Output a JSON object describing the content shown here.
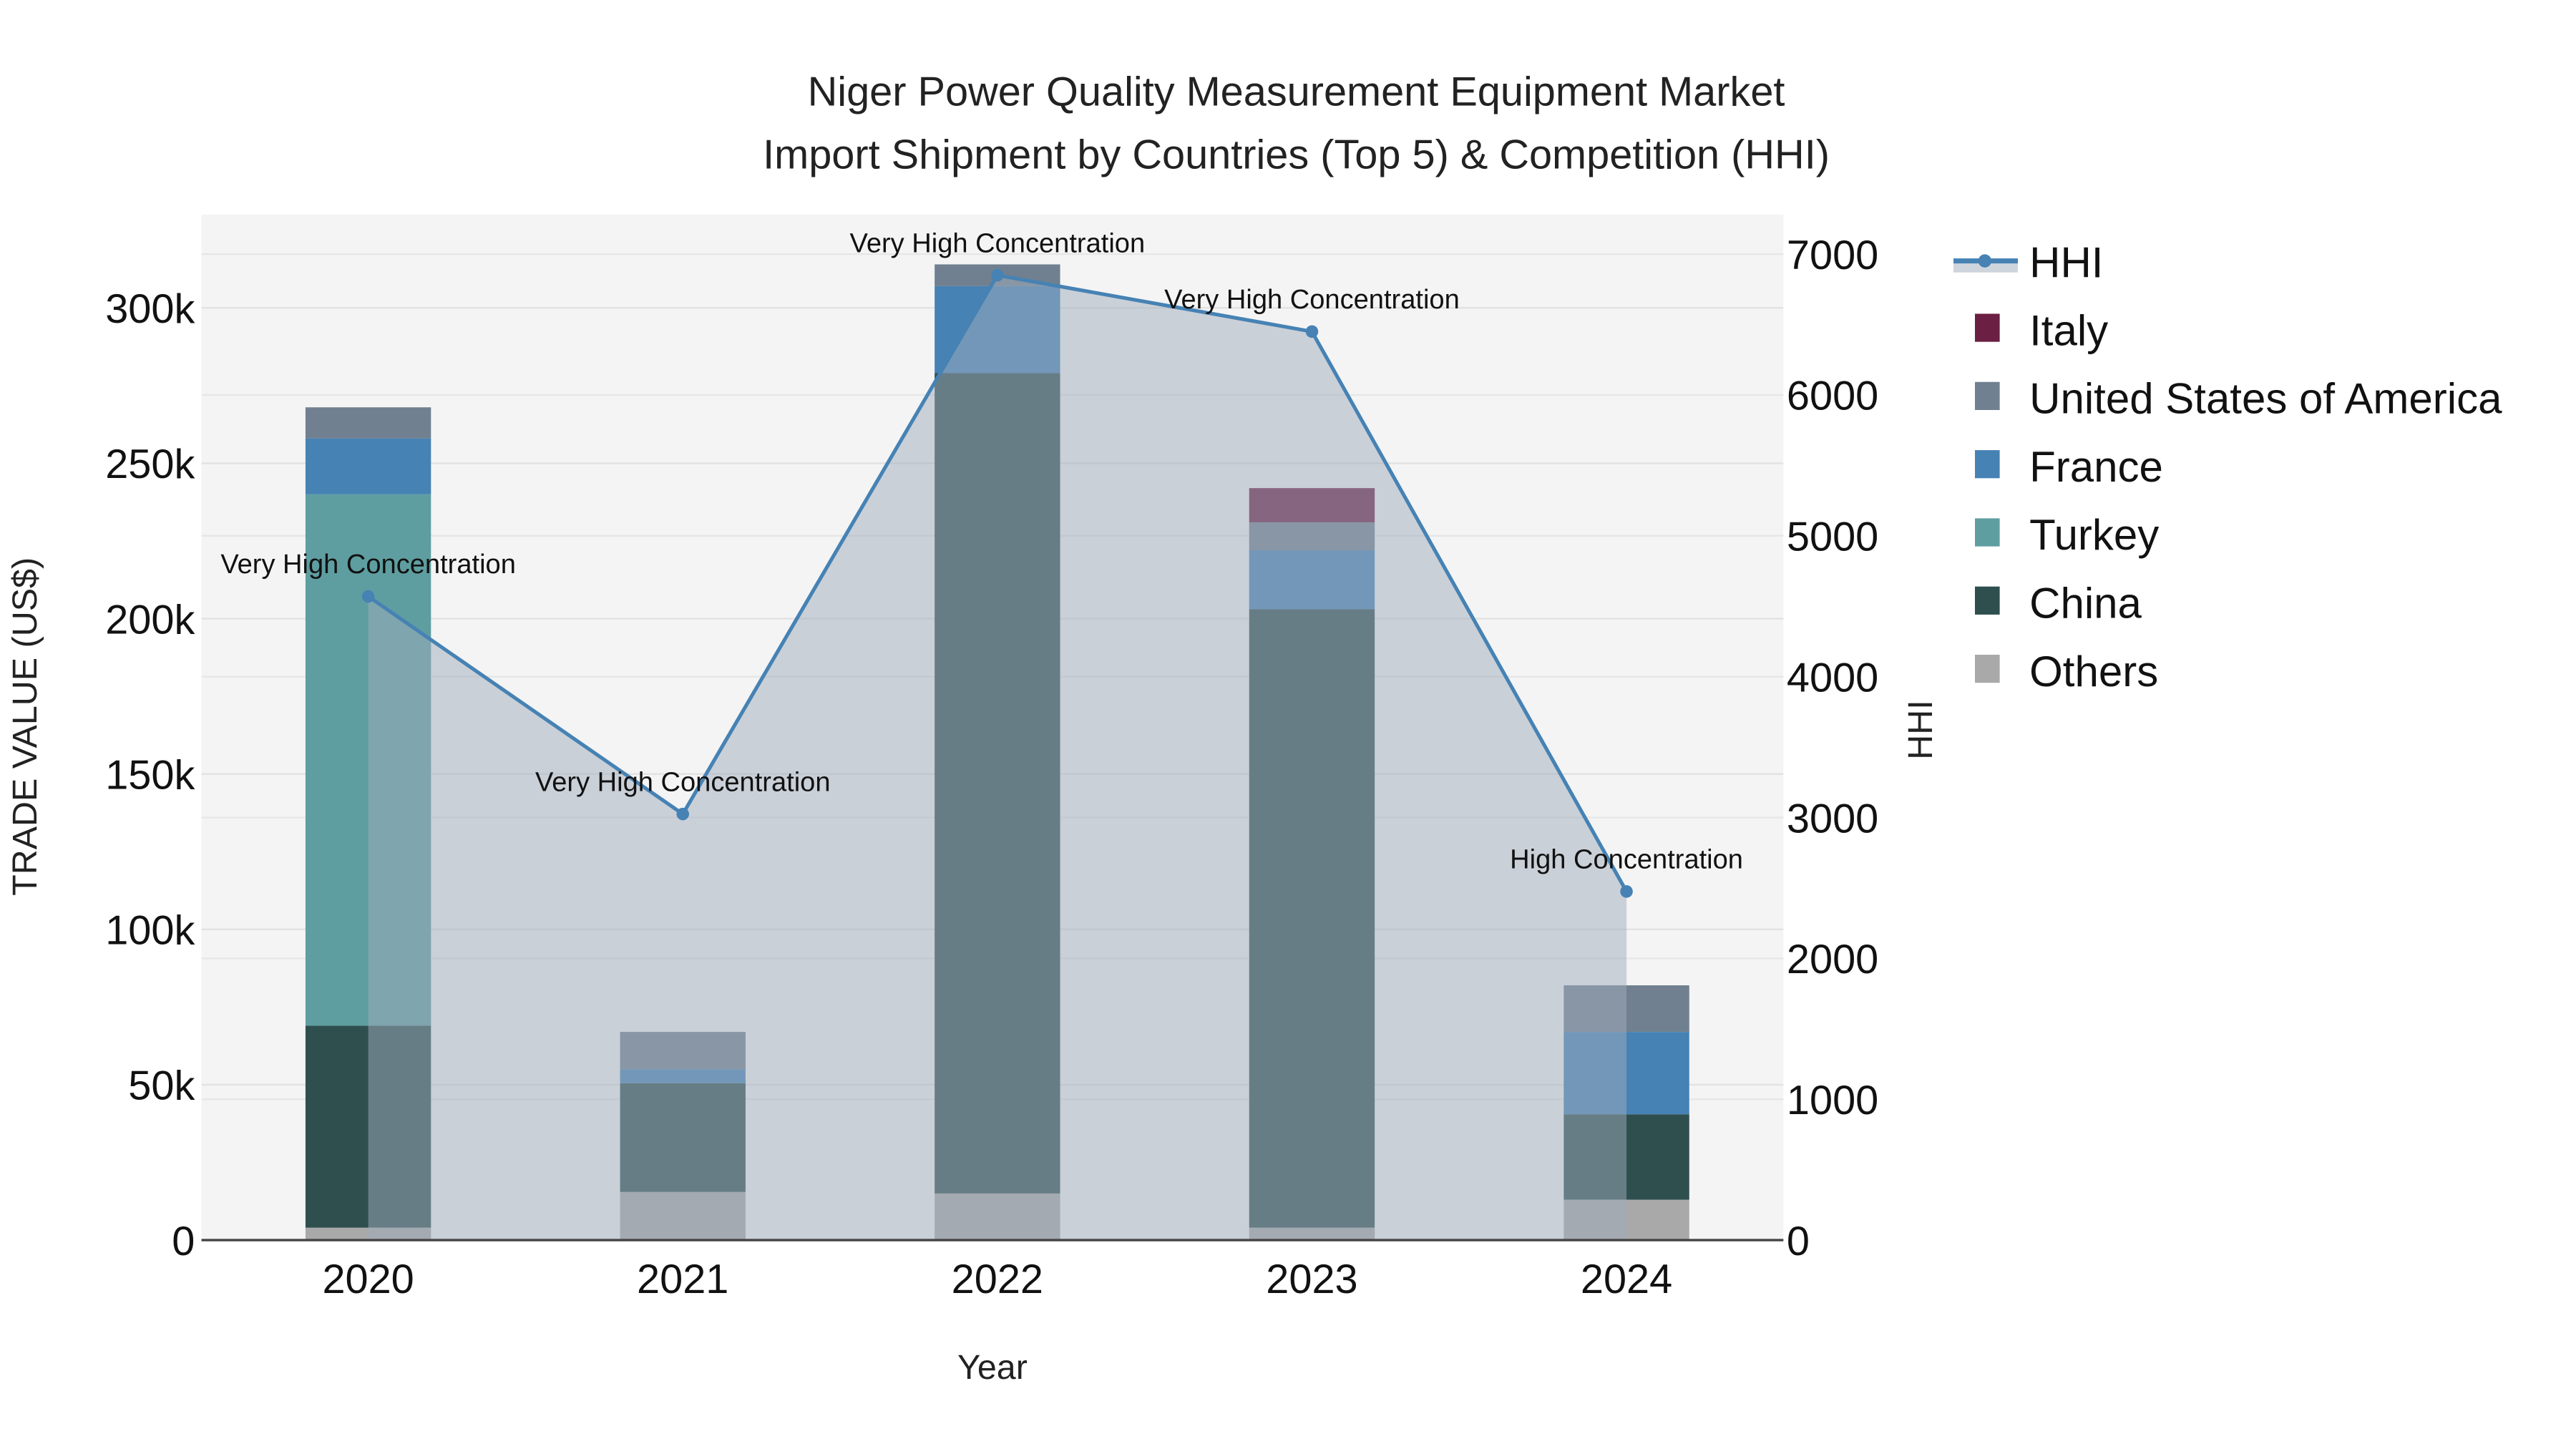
{
  "chart_data": {
    "type": "bar",
    "title_line1": "Niger Power Quality Measurement Equipment Market",
    "title_line2": "Import Shipment by Countries (Top 5) & Competition (HHI)",
    "xlabel": "Year",
    "ylabel": "TRADE VALUE (US$)",
    "y2label": "HHI",
    "categories": [
      "2020",
      "2021",
      "2022",
      "2023",
      "2024"
    ],
    "ylim": [
      0,
      330000
    ],
    "y2lim": [
      0,
      7280
    ],
    "yticks": [
      0,
      50000,
      100000,
      150000,
      200000,
      250000,
      300000
    ],
    "ytick_labels": [
      "0",
      "50k",
      "100k",
      "150k",
      "200k",
      "250k",
      "300k"
    ],
    "y2ticks": [
      0,
      1000,
      2000,
      3000,
      4000,
      5000,
      6000,
      7000
    ],
    "y2tick_labels": [
      "0",
      "1000",
      "2000",
      "3000",
      "4000",
      "5000",
      "6000",
      "7000"
    ],
    "series": [
      {
        "name": "Others",
        "color": "#a9a9a9",
        "values": [
          4000,
          15500,
          15000,
          4000,
          13000
        ]
      },
      {
        "name": "China",
        "color": "#2f4f4f",
        "values": [
          65000,
          35000,
          264000,
          199000,
          27500
        ]
      },
      {
        "name": "Turkey",
        "color": "#5f9ea0",
        "values": [
          171000,
          0,
          0,
          0,
          0
        ]
      },
      {
        "name": "France",
        "color": "#4682b4",
        "values": [
          18000,
          4500,
          28000,
          19000,
          26500
        ]
      },
      {
        "name": "United States of America",
        "color": "#708090",
        "values": [
          10000,
          12000,
          7000,
          9000,
          15000
        ]
      },
      {
        "name": "Italy",
        "color": "#6b1f42",
        "values": [
          0,
          0,
          0,
          11000,
          0
        ]
      }
    ],
    "hhi": {
      "name": "HHI",
      "color": "#4682b4",
      "values": [
        4570,
        3025,
        6850,
        6450,
        2475
      ],
      "annotations": [
        "Very High Concentration",
        "Very High Concentration",
        "Very High Concentration",
        "Very High Concentration",
        "High Concentration"
      ]
    },
    "legend_order": [
      "HHI",
      "Italy",
      "United States of America",
      "France",
      "Turkey",
      "China",
      "Others"
    ],
    "legend_position": "right",
    "grid": true
  }
}
